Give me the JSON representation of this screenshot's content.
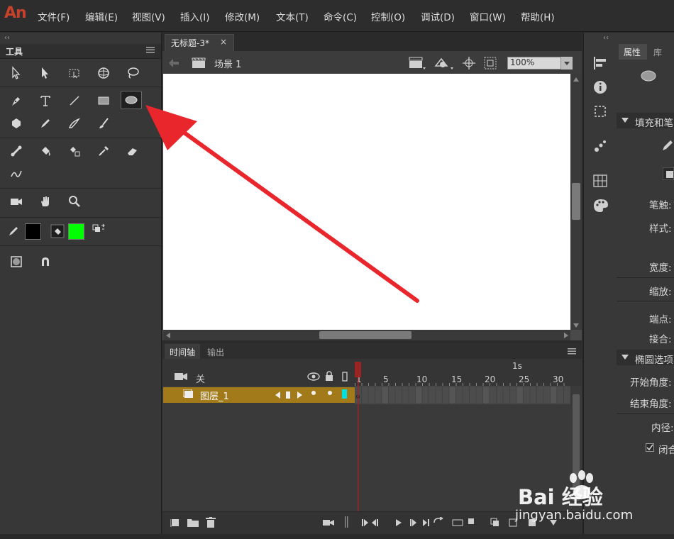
{
  "app": {
    "logo": "An"
  },
  "menu": [
    "文件(F)",
    "编辑(E)",
    "视图(V)",
    "插入(I)",
    "修改(M)",
    "文本(T)",
    "命令(C)",
    "控制(O)",
    "调试(D)",
    "窗口(W)",
    "帮助(H)"
  ],
  "tools_panel": {
    "title": "工具",
    "collapse_glyph": "‹‹"
  },
  "colors": {
    "stroke": "#000000",
    "fill": "#00ff00",
    "accent": "#a37a1a",
    "arrow": "#e8262c",
    "playhead": "#9a2424"
  },
  "document": {
    "tab_label": "无标题-3*",
    "close_glyph": "×",
    "scene": "场景 1",
    "zoom": "100%"
  },
  "timeline": {
    "tab_active": "时间轴",
    "tab_output": "输出",
    "camera_label": "关",
    "layer_name": "图层_1",
    "ruler_marks": [
      "1",
      "5",
      "10",
      "15",
      "20",
      "25",
      "30"
    ],
    "ruler_second": "1s"
  },
  "properties": {
    "tab_props": "属性",
    "tab_library": "库",
    "section_fill": "填充和笔",
    "stroke_label": "笔触:",
    "style_label": "样式:",
    "width_label": "宽度:",
    "scale_label": "缩放:",
    "cap_label": "端点:",
    "join_label": "接合:",
    "section_ellipse": "椭圆选项",
    "start_angle": "开始角度:",
    "end_angle": "结束角度:",
    "inner_radius": "内径:",
    "close_path": "闭合"
  },
  "watermark": {
    "logo": "Bai 经验",
    "url": "jingyan.baidu.com"
  }
}
